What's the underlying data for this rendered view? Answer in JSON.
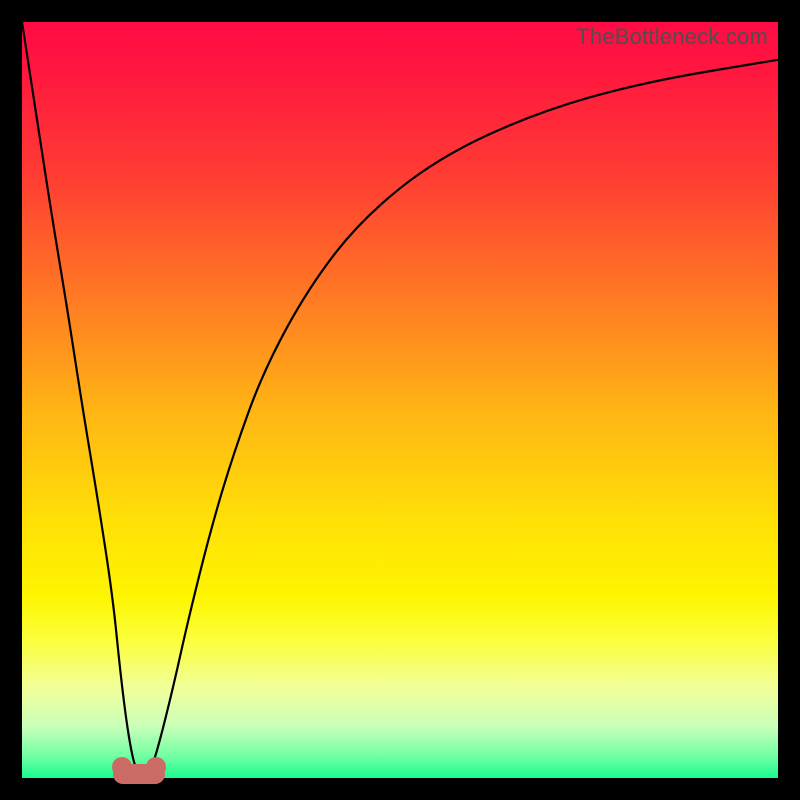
{
  "watermark": "TheBottleneck.com",
  "chart_data": {
    "type": "line",
    "title": "",
    "xlabel": "",
    "ylabel": "",
    "xlim": [
      0,
      100
    ],
    "ylim": [
      0,
      100
    ],
    "grid": false,
    "series": [
      {
        "name": "bottleneck-curve",
        "x": [
          0,
          2,
          4,
          6,
          8,
          10,
          12,
          13,
          14,
          15,
          16,
          17,
          18,
          20,
          22,
          25,
          28,
          32,
          38,
          45,
          55,
          68,
          82,
          100
        ],
        "values": [
          100,
          87,
          74,
          62,
          49,
          37,
          24,
          14,
          6,
          1,
          0.5,
          1,
          4,
          12,
          21,
          33,
          43,
          54,
          65,
          74,
          82,
          88,
          92,
          95
        ]
      }
    ],
    "marker_x": 15.5,
    "gradient_stops": [
      {
        "pos": 0,
        "color": "#ff0b45"
      },
      {
        "pos": 6,
        "color": "#ff163f"
      },
      {
        "pos": 20,
        "color": "#ff3b33"
      },
      {
        "pos": 37,
        "color": "#ff7c23"
      },
      {
        "pos": 52,
        "color": "#ffb714"
      },
      {
        "pos": 66,
        "color": "#ffe007"
      },
      {
        "pos": 76,
        "color": "#fef500"
      },
      {
        "pos": 82,
        "color": "#fbff3e"
      },
      {
        "pos": 88,
        "color": "#f1ff99"
      },
      {
        "pos": 93,
        "color": "#ccffb9"
      },
      {
        "pos": 97,
        "color": "#74ffa3"
      },
      {
        "pos": 100,
        "color": "#1bfc90"
      }
    ]
  }
}
